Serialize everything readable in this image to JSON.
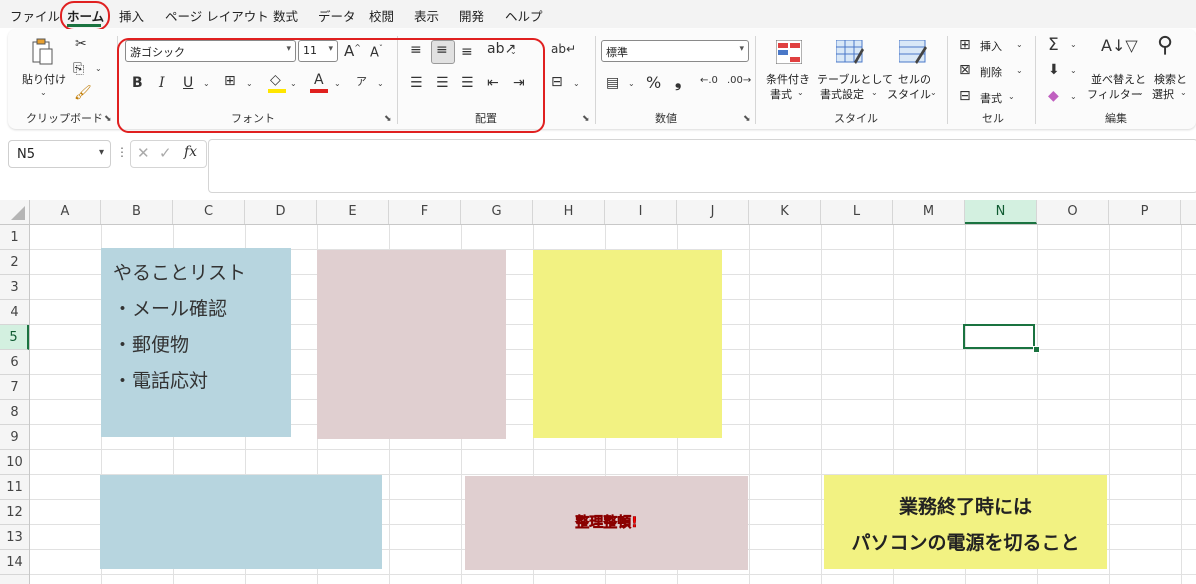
{
  "menu": {
    "tabs": [
      "ファイル",
      "ホーム",
      "挿入",
      "ページ レイアウト",
      "数式",
      "データ",
      "校閲",
      "表示",
      "開発",
      "ヘルプ"
    ],
    "active_tab": "ホーム"
  },
  "ribbon": {
    "clipboard": {
      "paste_label": "貼り付け",
      "group_label": "クリップボード"
    },
    "font": {
      "font_name": "游ゴシック",
      "font_size": "11",
      "bold": "B",
      "italic": "I",
      "underline": "U",
      "group_label": "フォント",
      "highlight_color": "#ffe600",
      "font_color": "#e0201e"
    },
    "alignment": {
      "group_label": "配置"
    },
    "number": {
      "format": "標準",
      "percent": "%",
      "comma": "❟",
      "group_label": "数値"
    },
    "styles": {
      "conditional_label_1": "条件付き",
      "conditional_label_2": "書式",
      "table_label_1": "テーブルとして",
      "table_label_2": "書式設定",
      "cell_style_label_1": "セルの",
      "cell_style_label_2": "スタイル",
      "group_label": "スタイル"
    },
    "cells": {
      "insert_label": "挿入",
      "delete_label": "削除",
      "format_label": "書式",
      "group_label": "セル"
    },
    "editing": {
      "sort_label_1": "並べ替えと",
      "sort_label_2": "フィルター",
      "find_label_1": "検索と",
      "find_label_2": "選択",
      "group_label": "編集"
    }
  },
  "formula_bar": {
    "name_box": "N5",
    "fx": "fx",
    "formula": ""
  },
  "grid": {
    "columns": [
      "A",
      "B",
      "C",
      "D",
      "E",
      "F",
      "G",
      "H",
      "I",
      "J",
      "K",
      "L",
      "M",
      "N",
      "O",
      "P"
    ],
    "rows": [
      "1",
      "2",
      "3",
      "4",
      "5",
      "6",
      "7",
      "8",
      "9",
      "10",
      "11",
      "12",
      "13",
      "14"
    ],
    "selected_cell": "N5"
  },
  "shapes": {
    "todo": {
      "title": "やることリスト",
      "items": [
        "・メール確認",
        "・郵便物",
        "・電話応対"
      ],
      "color": "#b7d5df"
    },
    "pink_note": {
      "color": "#e0cfd0"
    },
    "yellow_note": {
      "color": "#f2f282"
    },
    "blue_bar": {
      "color": "#b7d5df"
    },
    "tidy_note": {
      "text": "整理整頓!",
      "color": "#e0cfd0",
      "text_color": "#ff0000"
    },
    "reminder": {
      "line1": "業務終了時には",
      "line2": "パソコンの電源を切ること",
      "color": "#f2f282"
    }
  }
}
